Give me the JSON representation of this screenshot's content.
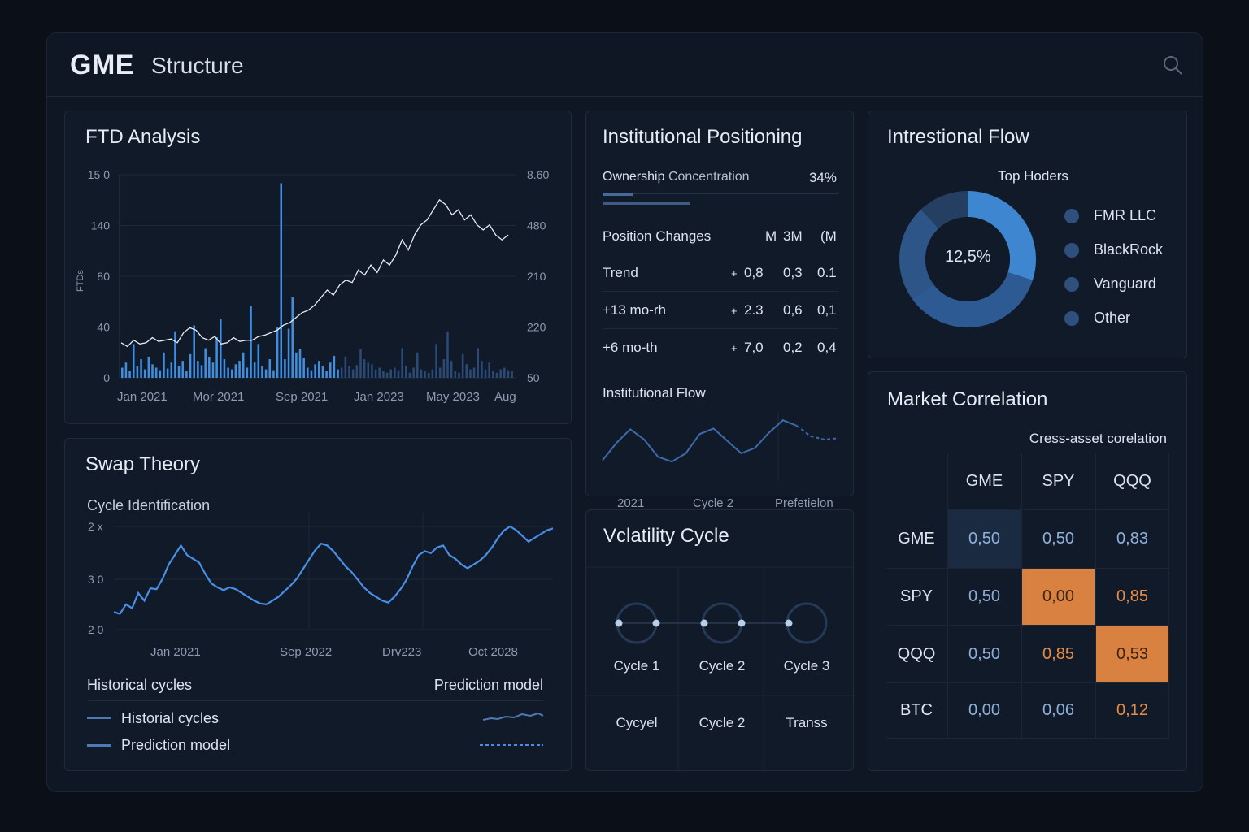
{
  "header": {
    "ticker": "GME",
    "title": "Structure"
  },
  "ftd": {
    "title": "FTD Analysis",
    "y_left_label": "FTDs",
    "chart_data": {
      "type": "bar",
      "title": "FTD Analysis",
      "y_left_ticks": [
        "15 0",
        "140",
        "80",
        "40",
        "0"
      ],
      "y_right_ticks": [
        "8.60",
        "480",
        "210",
        "220",
        "50"
      ],
      "x_ticks": [
        "Jan 2021",
        "Mor 2021",
        "Sep 2021",
        "Jan 2023",
        "May 2023",
        "Aug"
      ],
      "ylim": [
        0,
        150
      ],
      "bars": [
        12,
        18,
        8,
        40,
        14,
        22,
        10,
        25,
        16,
        12,
        9,
        30,
        11,
        18,
        55,
        14,
        20,
        8,
        28,
        62,
        20,
        15,
        35,
        25,
        18,
        48,
        70,
        22,
        12,
        10,
        16,
        20,
        30,
        12,
        85,
        18,
        40,
        14,
        10,
        22,
        9,
        60,
        230,
        22,
        58,
        95,
        30,
        34,
        24,
        12,
        9,
        16,
        20,
        14,
        8,
        18,
        26,
        10,
        12,
        25,
        14,
        10,
        15,
        34,
        22,
        18,
        16,
        10,
        12,
        8,
        6,
        10,
        12,
        9,
        35,
        14,
        6,
        12,
        30,
        10,
        8,
        6,
        10,
        40,
        12,
        22,
        55,
        20,
        8,
        6,
        28,
        16,
        10,
        12,
        35,
        20,
        10,
        18,
        8,
        6,
        10,
        12,
        9,
        8
      ],
      "line_ylim": [
        50,
        860
      ],
      "line": [
        190,
        175,
        200,
        185,
        190,
        210,
        195,
        200,
        205,
        190,
        230,
        250,
        240,
        210,
        200,
        215,
        185,
        190,
        210,
        195,
        200,
        200,
        215,
        220,
        230,
        240,
        260,
        270,
        290,
        310,
        320,
        340,
        370,
        400,
        380,
        420,
        440,
        430,
        480,
        460,
        500,
        470,
        520,
        500,
        540,
        600,
        560,
        620,
        660,
        680,
        720,
        760,
        740,
        700,
        720,
        680,
        700,
        660,
        640,
        660,
        620,
        600,
        620
      ]
    }
  },
  "swap": {
    "title": "Swap Theory",
    "subtitle": "Cycle Identification",
    "chart_data": {
      "type": "line",
      "y_ticks": [
        "2 x",
        "3 0",
        "2 0"
      ],
      "x_ticks": [
        "Jan 2021",
        "Sep 2022",
        "Drv223",
        "Oct 2028"
      ],
      "series": [
        {
          "values": [
            10,
            8,
            18,
            14,
            30,
            22,
            35,
            34,
            45,
            60,
            70,
            80,
            70,
            66,
            62,
            50,
            40,
            36,
            33,
            36,
            34,
            30,
            26,
            22,
            19,
            18,
            22,
            26,
            32,
            38,
            45,
            55,
            65,
            75,
            82,
            80,
            74,
            66,
            58,
            52,
            44,
            36,
            30,
            26,
            22,
            20,
            26,
            34,
            44,
            58,
            70,
            74,
            72,
            78,
            80,
            70,
            66,
            60,
            56,
            60,
            64,
            70,
            78,
            88,
            96,
            100,
            96,
            90,
            84,
            88,
            92,
            96,
            98
          ]
        }
      ]
    },
    "legend_header_left": "Historical cycles",
    "legend_header_right": "Prediction model",
    "legend": [
      {
        "label": "Historial cycles",
        "color": "#4f79b3"
      },
      {
        "label": "Prediction model",
        "color": "#4f79b3"
      }
    ]
  },
  "institutional": {
    "title": "Institutional Positioning",
    "ownership_label_a": "Ownership",
    "ownership_label_b": "Concentration",
    "ownership_value": "34%",
    "ownership_pct": 0.34,
    "changes_header": "Position Changes",
    "col_headers": [
      "M",
      "3M",
      "(M"
    ],
    "rows": [
      {
        "label": "Trend",
        "sign": "+",
        "v1": "0,8",
        "v2": "0,3",
        "v3": "0.1"
      },
      {
        "label": "+13 mo-rh",
        "sign": "+",
        "v1": "2.3",
        "v2": "0,6",
        "v3": "0,1"
      },
      {
        "label": "+6 mo-th",
        "sign": "+",
        "v1": "7,0",
        "v2": "0,2",
        "v3": "0,4"
      }
    ],
    "flow_title": "Institutional Flow",
    "flow_x_ticks": [
      "2021",
      "Cycle 2",
      "Prefetielon"
    ],
    "flow_chart": {
      "type": "line",
      "values": [
        30,
        55,
        75,
        60,
        35,
        28,
        40,
        68,
        76,
        58,
        40,
        48,
        70,
        88,
        80,
        65,
        60,
        62
      ]
    }
  },
  "volatility": {
    "title": "Vclatility Cycle",
    "cycles": [
      "Cycle 1",
      "Cycle 2",
      "Cycle 3"
    ],
    "bottom": [
      "Cycyel",
      "Cycle 2",
      "Transs"
    ]
  },
  "flow": {
    "title": "Intrestional Flow",
    "subtitle": "Top Hoders",
    "center_value": "12,5%",
    "chart_data": {
      "type": "pie",
      "slices": [
        {
          "name": "FMR LLC",
          "value": 30,
          "color": "#3e86d0"
        },
        {
          "name": "BlackRock",
          "value": 35,
          "color": "#2e5a93"
        },
        {
          "name": "Vanguard",
          "value": 23,
          "color": "#2d5587"
        },
        {
          "name": "Other",
          "value": 12,
          "color": "#253f63"
        }
      ]
    },
    "legend": [
      "FMR LLC",
      "BlackRock",
      "Vanguard",
      "Other"
    ]
  },
  "correlation": {
    "title": "Market Correlation",
    "subtitle": "Cress-asset corelation",
    "cols": [
      "GME",
      "SPY",
      "QQQ"
    ],
    "rows": [
      "GME",
      "SPY",
      "QQQ",
      "BTC"
    ],
    "values": [
      [
        "0,50",
        "0,50",
        "0,83"
      ],
      [
        "0,50",
        "0,00",
        "0,85"
      ],
      [
        "0,50",
        "0,85",
        "0,53"
      ],
      [
        "0,00",
        "0,06",
        "0,12"
      ]
    ],
    "highlight": [
      [
        "dark",
        "",
        ""
      ],
      [
        "",
        "orange",
        "orange-text"
      ],
      [
        "",
        "orange-text",
        "orange"
      ],
      [
        "",
        "",
        "orange-text"
      ]
    ],
    "colors": {
      "blue_text": "#8fb0dc",
      "orange": "#d98140",
      "orange_text": "#e98c44",
      "dark": "#1a2a40"
    }
  }
}
